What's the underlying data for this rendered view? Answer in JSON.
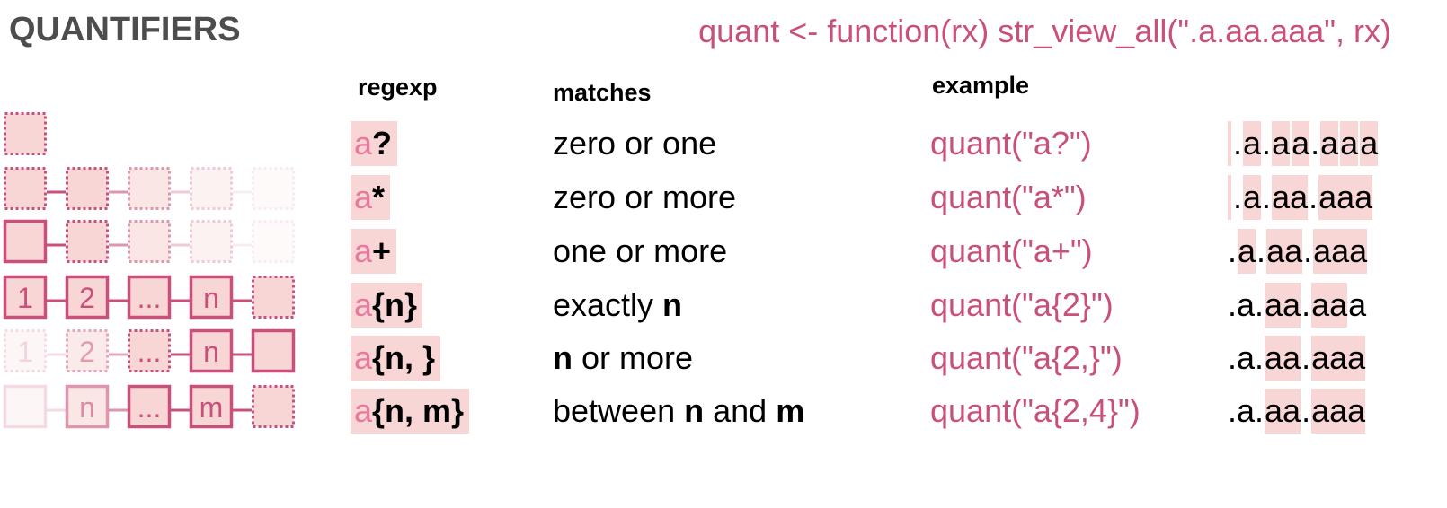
{
  "title": "QUANTIFIERS",
  "code": "quant <- function(rx) str_view_all(\".a.aa.aaa\", rx)",
  "headers": {
    "regexp": "regexp",
    "matches": "matches",
    "example": "example"
  },
  "colors": {
    "accent": "#c9507a",
    "highlight": "#f9d6d6",
    "title": "#4d4d4d"
  },
  "rows": [
    {
      "rx_a": "a",
      "rx_q": "?",
      "matches": [
        {
          "t": "zero or one",
          "b": false
        }
      ],
      "example": "quant(\"a?\")",
      "result": [
        {
          "t": "",
          "m": "empty"
        },
        {
          "t": ".",
          "m": "no"
        },
        {
          "t": "a",
          "m": "hl"
        },
        {
          "t": ".",
          "m": "no"
        },
        {
          "t": "a",
          "m": "hl"
        },
        {
          "t": "a",
          "m": "hl"
        },
        {
          "t": ".",
          "m": "no"
        },
        {
          "t": "a",
          "m": "hl"
        },
        {
          "t": "a",
          "m": "hl"
        },
        {
          "t": "a",
          "m": "hl"
        }
      ]
    },
    {
      "rx_a": "a",
      "rx_q": "*",
      "matches": [
        {
          "t": "zero or more",
          "b": false
        }
      ],
      "example": "quant(\"a*\")",
      "result": [
        {
          "t": "",
          "m": "empty"
        },
        {
          "t": ".",
          "m": "no"
        },
        {
          "t": "a",
          "m": "hl"
        },
        {
          "t": ".",
          "m": "no"
        },
        {
          "t": "aa",
          "m": "hl"
        },
        {
          "t": ".",
          "m": "no"
        },
        {
          "t": "aaa",
          "m": "hl"
        }
      ]
    },
    {
      "rx_a": "a",
      "rx_q": "+",
      "matches": [
        {
          "t": "one or more",
          "b": false
        }
      ],
      "example": "quant(\"a+\")",
      "result": [
        {
          "t": ".",
          "m": "no"
        },
        {
          "t": "a",
          "m": "hl"
        },
        {
          "t": ".",
          "m": "no"
        },
        {
          "t": "aa",
          "m": "hl"
        },
        {
          "t": ".",
          "m": "no"
        },
        {
          "t": "aaa",
          "m": "hl"
        }
      ]
    },
    {
      "rx_a": "a",
      "rx_q": "{n}",
      "matches": [
        {
          "t": "exactly ",
          "b": false
        },
        {
          "t": "n",
          "b": true
        }
      ],
      "example": "quant(\"a{2}\")",
      "result": [
        {
          "t": ".a.",
          "m": "no"
        },
        {
          "t": "aa",
          "m": "hl"
        },
        {
          "t": ".",
          "m": "no"
        },
        {
          "t": "aa",
          "m": "hl"
        },
        {
          "t": "a",
          "m": "no"
        }
      ]
    },
    {
      "rx_a": "a",
      "rx_q": "{n, }",
      "matches": [
        {
          "t": "n",
          "b": true
        },
        {
          "t": " or more",
          "b": false
        }
      ],
      "example": "quant(\"a{2,}\")",
      "result": [
        {
          "t": ".a.",
          "m": "no"
        },
        {
          "t": "aa",
          "m": "hl"
        },
        {
          "t": ".",
          "m": "no"
        },
        {
          "t": "aaa",
          "m": "hl"
        }
      ]
    },
    {
      "rx_a": "a",
      "rx_q": "{n, m}",
      "matches": [
        {
          "t": "between ",
          "b": false
        },
        {
          "t": "n",
          "b": true
        },
        {
          "t": " and ",
          "b": false
        },
        {
          "t": "m",
          "b": true
        }
      ],
      "example": "quant(\"a{2,4}\")",
      "result": [
        {
          "t": ".a.",
          "m": "no"
        },
        {
          "t": "aa",
          "m": "hl"
        },
        {
          "t": ".",
          "m": "no"
        },
        {
          "t": "aaa",
          "m": "hl"
        }
      ]
    }
  ],
  "diagrams": [
    {
      "boxes": [
        {
          "label": "",
          "style": "dotted"
        }
      ]
    },
    {
      "boxes": [
        {
          "label": "",
          "style": "dotted"
        },
        {
          "label": "",
          "style": "dotted"
        },
        {
          "label": "",
          "style": "dotted"
        },
        {
          "label": "",
          "style": "dotted"
        },
        {
          "label": "",
          "style": "dotted"
        }
      ]
    },
    {
      "boxes": [
        {
          "label": "",
          "style": "solid"
        },
        {
          "label": "",
          "style": "dotted"
        },
        {
          "label": "",
          "style": "dotted"
        },
        {
          "label": "",
          "style": "dotted"
        },
        {
          "label": "",
          "style": "dotted"
        }
      ]
    },
    {
      "boxes": [
        {
          "label": "1",
          "style": "solid"
        },
        {
          "label": "2",
          "style": "solid"
        },
        {
          "label": "...",
          "style": "solid"
        },
        {
          "label": "n",
          "style": "solid"
        },
        {
          "label": "",
          "style": "dotted"
        }
      ]
    },
    {
      "boxes": [
        {
          "label": "1",
          "style": "dotted"
        },
        {
          "label": "2",
          "style": "dotted"
        },
        {
          "label": "...",
          "style": "dotted"
        },
        {
          "label": "n",
          "style": "solid"
        },
        {
          "label": "",
          "style": "solid"
        }
      ]
    },
    {
      "boxes": [
        {
          "label": "",
          "style": "solid"
        },
        {
          "label": "n",
          "style": "solid"
        },
        {
          "label": "...",
          "style": "solid"
        },
        {
          "label": "m",
          "style": "solid"
        },
        {
          "label": "",
          "style": "dotted"
        }
      ]
    }
  ]
}
